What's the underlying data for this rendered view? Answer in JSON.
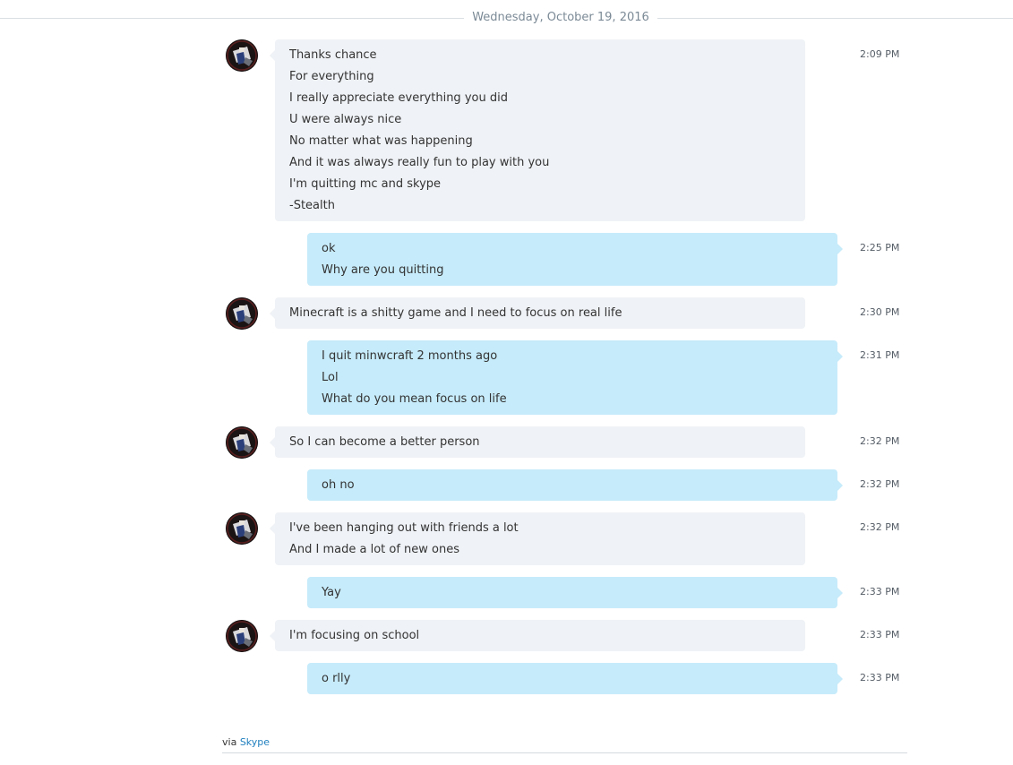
{
  "date_divider": "Wednesday, October 19, 2016",
  "messages": [
    {
      "direction": "in",
      "time": "2:09 PM",
      "lines": [
        "Thanks chance",
        "For everything",
        "I really appreciate everything you did",
        "U were always nice",
        "No matter what was happening",
        "And it was always really fun to play with you",
        "I'm quitting mc and skype",
        "-Stealth"
      ]
    },
    {
      "direction": "out",
      "time": "2:25 PM",
      "lines": [
        "ok",
        "Why are you quitting"
      ]
    },
    {
      "direction": "in",
      "time": "2:30 PM",
      "lines": [
        "Minecraft is a shitty game and I need to focus on real life"
      ]
    },
    {
      "direction": "out",
      "time": "2:31 PM",
      "lines": [
        "I quit minwcraft 2 months ago",
        "Lol",
        "What do you mean focus on life"
      ]
    },
    {
      "direction": "in",
      "time": "2:32 PM",
      "lines": [
        "So I can become a better person"
      ]
    },
    {
      "direction": "out",
      "time": "2:32 PM",
      "lines": [
        "oh no"
      ]
    },
    {
      "direction": "in",
      "time": "2:32 PM",
      "lines": [
        "I've been hanging out with friends a lot",
        "And I made a lot of new ones"
      ]
    },
    {
      "direction": "out",
      "time": "2:33 PM",
      "lines": [
        "Yay"
      ]
    },
    {
      "direction": "in",
      "time": "2:33 PM",
      "lines": [
        "I'm focusing on school"
      ]
    },
    {
      "direction": "out",
      "time": "2:33 PM",
      "lines": [
        "o rlly"
      ]
    }
  ],
  "footer": {
    "via_label": "via",
    "link_label": "Skype"
  },
  "colors": {
    "incoming_bubble": "#eff2f6",
    "outgoing_bubble": "#c6ebfa",
    "link": "#1f7fbf"
  },
  "icons": {
    "avatar": "contact-avatar-icon"
  }
}
